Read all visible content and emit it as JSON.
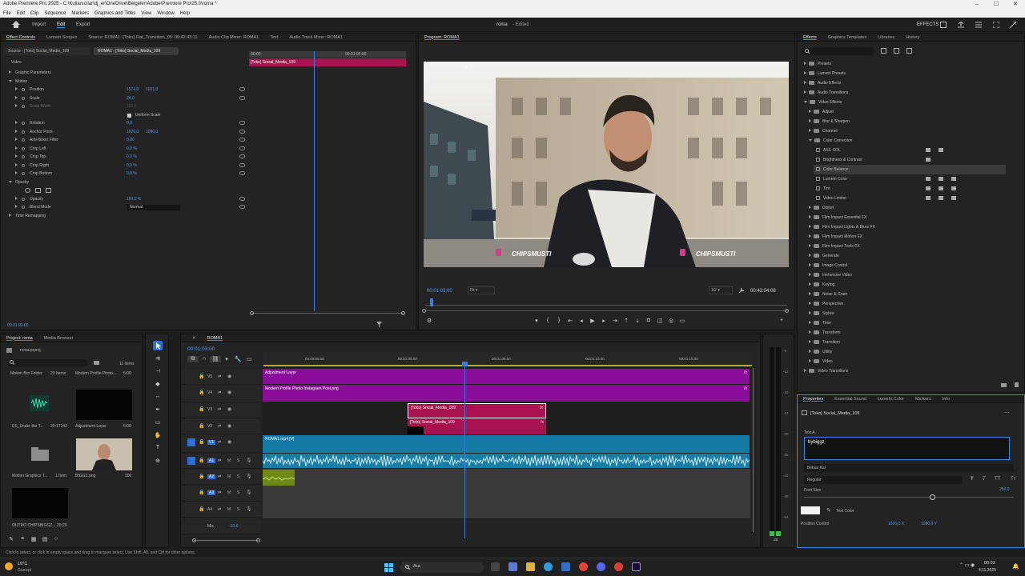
{
  "window": {
    "title": "Adobe Premiere Pro 2025 - C:\\Kullanıcılar\\dj_er\\OneDrive\\Belgeler\\Adobe\\Premiere Pro\\25.0\\roma *",
    "minimize": "–",
    "maximize": "☐",
    "close": "✕"
  },
  "menu": [
    "File",
    "Edit",
    "Clip",
    "Sequence",
    "Markers",
    "Graphics and Titles",
    "View",
    "Window",
    "Help"
  ],
  "app": {
    "home_icon": "home-icon",
    "import": "Import",
    "edit": "Edit",
    "export": "Export",
    "project_title": "roma",
    "status": "- Edited",
    "workspace": "EFFECTS"
  },
  "effect_controls": {
    "tabs": [
      "Effect Controls",
      "Lumetri Scopes",
      "Source: ROMA1: [Toko] Flat_Transition_05: 00:42:43:11",
      "Audio Clip Mixer: ROMA1",
      "Text",
      "Audio Track Mixer: ROMA1"
    ],
    "source_label": "Source - [Toko] Social_Media_109",
    "seq_label": "ROMA1 - [Toko] Social_Media_109",
    "section_video": "Video",
    "rows": [
      {
        "name": "Graphic Parameters",
        "v1": "",
        "v2": "",
        "level": 1
      },
      {
        "name": "Motion",
        "v1": "",
        "v2": "",
        "level": 1
      },
      {
        "name": "Position",
        "v1": "1574,0",
        "v2": "1021,0",
        "level": 2
      },
      {
        "name": "Scale",
        "v1": "24,0",
        "v2": "",
        "level": 2
      },
      {
        "name": "Scale Width",
        "v1": "100,0",
        "v2": "",
        "level": 2
      },
      {
        "name": "Uniform Scale",
        "v1": "",
        "v2": "",
        "level": 3
      },
      {
        "name": "Rotation",
        "v1": "0,0",
        "v2": "",
        "level": 2
      },
      {
        "name": "Anchor Point",
        "v1": "1920,0",
        "v2": "1080,0",
        "level": 2
      },
      {
        "name": "Anti-flicker Filter",
        "v1": "0,00",
        "v2": "",
        "level": 2
      },
      {
        "name": "Crop Left",
        "v1": "0,0 %",
        "v2": "",
        "level": 2
      },
      {
        "name": "Crop Top",
        "v1": "0,0 %",
        "v2": "",
        "level": 2
      },
      {
        "name": "Crop Right",
        "v1": "0,0 %",
        "v2": "",
        "level": 2
      },
      {
        "name": "Crop Bottom",
        "v1": "0,0 %",
        "v2": "",
        "level": 2
      },
      {
        "name": "Opacity",
        "v1": "",
        "v2": "",
        "level": 1
      },
      {
        "name": "",
        "v1": "",
        "v2": "",
        "level": 2
      },
      {
        "name": "Opacity",
        "v1": "100,0 %",
        "v2": "",
        "level": 2
      },
      {
        "name": "Blend Mode",
        "v1": "Normal",
        "v2": "",
        "level": 2
      },
      {
        "name": "Time Remapping",
        "v1": "",
        "v2": "",
        "level": 1
      }
    ],
    "mini_time": "00:00",
    "mini_time2": "00:01:05:00",
    "mini_clip": "[Toko] Social_Media_109",
    "timecode": "00:01:03:00"
  },
  "program": {
    "tab": "Program: ROMA1",
    "timecode": "00:01:03:00",
    "fit": "Fit",
    "quality": "1/2",
    "duration": "00:43:04:08",
    "overlay_left": "CHIPSMUSTI",
    "overlay_right": "CHIPSMUSTI",
    "weather": "19°C"
  },
  "effects_panel": {
    "tabs": [
      "Effects",
      "Graphics Templates",
      "Libraries",
      "History"
    ],
    "items": [
      {
        "label": "Presets",
        "indent": 0,
        "open": false,
        "badges": 0
      },
      {
        "label": "Lumetri Presets",
        "indent": 0,
        "open": false,
        "badges": 0
      },
      {
        "label": "Audio Effects",
        "indent": 0,
        "open": false,
        "badges": 0
      },
      {
        "label": "Audio Transitions",
        "indent": 0,
        "open": false,
        "badges": 0
      },
      {
        "label": "Video Effects",
        "indent": 0,
        "open": true,
        "badges": 0
      },
      {
        "label": "Adjust",
        "indent": 1,
        "open": false,
        "badges": 0
      },
      {
        "label": "Blur & Sharpen",
        "indent": 1,
        "open": false,
        "badges": 0
      },
      {
        "label": "Channel",
        "indent": 1,
        "open": false,
        "badges": 0
      },
      {
        "label": "Color Correction",
        "indent": 1,
        "open": true,
        "badges": 0
      },
      {
        "label": "ASC CDL",
        "indent": 2,
        "open": false,
        "badges": 2
      },
      {
        "label": "Brightness & Contrast",
        "indent": 2,
        "open": false,
        "badges": 1
      },
      {
        "label": "Color Balance",
        "indent": 2,
        "open": false,
        "badges": 0
      },
      {
        "label": "Lumetri Color",
        "indent": 2,
        "open": false,
        "badges": 3
      },
      {
        "label": "Tint",
        "indent": 2,
        "open": false,
        "badges": 3
      },
      {
        "label": "Video Limiter",
        "indent": 2,
        "open": false,
        "badges": 3
      },
      {
        "label": "Distort",
        "indent": 1,
        "open": false,
        "badges": 0
      },
      {
        "label": "Film Impact Essential FX",
        "indent": 1,
        "open": false,
        "badges": 0
      },
      {
        "label": "Film Impact Lights & Blurs FX",
        "indent": 1,
        "open": false,
        "badges": 0
      },
      {
        "label": "Film Impact Motion FX",
        "indent": 1,
        "open": false,
        "badges": 0
      },
      {
        "label": "Film Impact Tools FX",
        "indent": 1,
        "open": false,
        "badges": 0
      },
      {
        "label": "Generate",
        "indent": 1,
        "open": false,
        "badges": 0
      },
      {
        "label": "Image Control",
        "indent": 1,
        "open": false,
        "badges": 0
      },
      {
        "label": "Immersive Video",
        "indent": 1,
        "open": false,
        "badges": 0
      },
      {
        "label": "Keying",
        "indent": 1,
        "open": false,
        "badges": 0
      },
      {
        "label": "Noise & Grain",
        "indent": 1,
        "open": false,
        "badges": 0
      },
      {
        "label": "Perspective",
        "indent": 1,
        "open": false,
        "badges": 0
      },
      {
        "label": "Stylize",
        "indent": 1,
        "open": false,
        "badges": 0
      },
      {
        "label": "Time",
        "indent": 1,
        "open": false,
        "badges": 0
      },
      {
        "label": "Transform",
        "indent": 1,
        "open": false,
        "badges": 0
      },
      {
        "label": "Transition",
        "indent": 1,
        "open": false,
        "badges": 0
      },
      {
        "label": "Utility",
        "indent": 1,
        "open": false,
        "badges": 0
      },
      {
        "label": "Video",
        "indent": 1,
        "open": false,
        "badges": 0
      },
      {
        "label": "Video Transitions",
        "indent": 0,
        "open": false,
        "badges": 0
      }
    ]
  },
  "properties": {
    "tabs": [
      "Properties",
      "Essential Sound",
      "Lumetri Color",
      "Markers",
      "Info"
    ],
    "clip": "[Toko] Social_Media_109",
    "text_label": "Text A",
    "text_value": "bybiggz",
    "font": "Bebas Kai",
    "style": "Regular",
    "font_size_label": "Font Size",
    "font_size": "250,0",
    "text_color_label": "Text Color",
    "position_label": "Position Control",
    "pos_x": "1920,0 X",
    "pos_y": "1080,0 Y"
  },
  "project": {
    "tabs": [
      "Project: roma",
      "Media Browser"
    ],
    "file": "roma.prproj",
    "count": "11 items",
    "items": [
      {
        "name": "Motion Bro Folder",
        "meta": "20 Items"
      },
      {
        "name": "Modern Profile Photo...",
        "meta": "5:00"
      },
      {
        "name": "ES_Under the T...",
        "meta": "30:17142"
      },
      {
        "name": "Adjustment Layer",
        "meta": "5:00"
      },
      {
        "name": "Motion Graphics T...",
        "meta": "1 Item"
      },
      {
        "name": "BIGGZ.png",
        "meta": "300"
      },
      {
        "name": "OUTRO CHIPSBIGGZ...",
        "meta": "20:29"
      }
    ]
  },
  "timeline": {
    "tab": "ROMA1",
    "timecode": "00:01:03:00",
    "ruler": [
      "00:00:55:00",
      "00:01:00:00",
      "00:01:05:00",
      "00:01:10:00",
      "00:01:15:00"
    ],
    "tracks": [
      {
        "name": "V5"
      },
      {
        "name": "V4"
      },
      {
        "name": "V3"
      },
      {
        "name": "V2"
      },
      {
        "name": "V1"
      },
      {
        "name": "A1"
      },
      {
        "name": "A2"
      },
      {
        "name": "A3"
      },
      {
        "name": "A4"
      }
    ],
    "mix_label": "Mix",
    "mix_value": "-10,6",
    "clips": {
      "v5": "Adjustment Layer",
      "v4": "Modern Profile Photo Instagram Post.png",
      "v3": "[Toko] Social_Media_109",
      "v2": "[Toko] Social_Media_109",
      "v1": "ROMA1.mp4 [V]"
    },
    "meter_labels": [
      "-6",
      "-12",
      "-18",
      "-24",
      "-30",
      "-36",
      "-42",
      "-48",
      "-54"
    ],
    "meter_bottom": "dB"
  },
  "status_text": "Click to select, or click in empty space and drag to marquee select. Use Shift, Alt, and Ctrl for other options.",
  "taskbar": {
    "weather": "19°C",
    "weather_sub": "Güneşli",
    "search": "Ara",
    "time": "00:02",
    "date": "4.11.2025"
  }
}
